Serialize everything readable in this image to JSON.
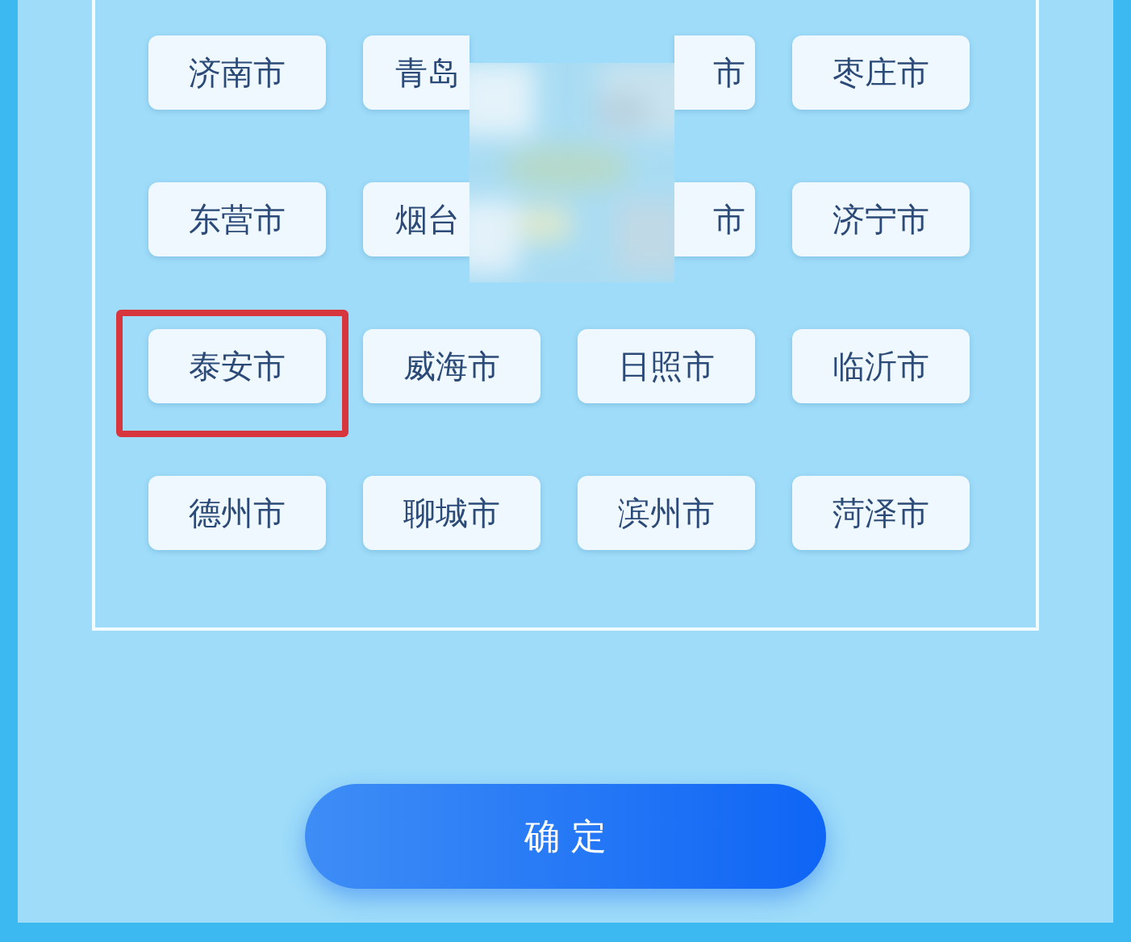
{
  "cities": [
    {
      "name": "济南市",
      "selected": false
    },
    {
      "name": "青岛",
      "selected": false
    },
    {
      "name": "市",
      "selected": false
    },
    {
      "name": "枣庄市",
      "selected": false
    },
    {
      "name": "东营市",
      "selected": false
    },
    {
      "name": "烟台",
      "selected": false
    },
    {
      "name": "市",
      "selected": false
    },
    {
      "name": "济宁市",
      "selected": false
    },
    {
      "name": "泰安市",
      "selected": true
    },
    {
      "name": "威海市",
      "selected": false
    },
    {
      "name": "日照市",
      "selected": false
    },
    {
      "name": "临沂市",
      "selected": false
    },
    {
      "name": "德州市",
      "selected": false
    },
    {
      "name": "聊城市",
      "selected": false
    },
    {
      "name": "滨州市",
      "selected": false
    },
    {
      "name": "菏泽市",
      "selected": false
    }
  ],
  "confirm_button": "确 定"
}
